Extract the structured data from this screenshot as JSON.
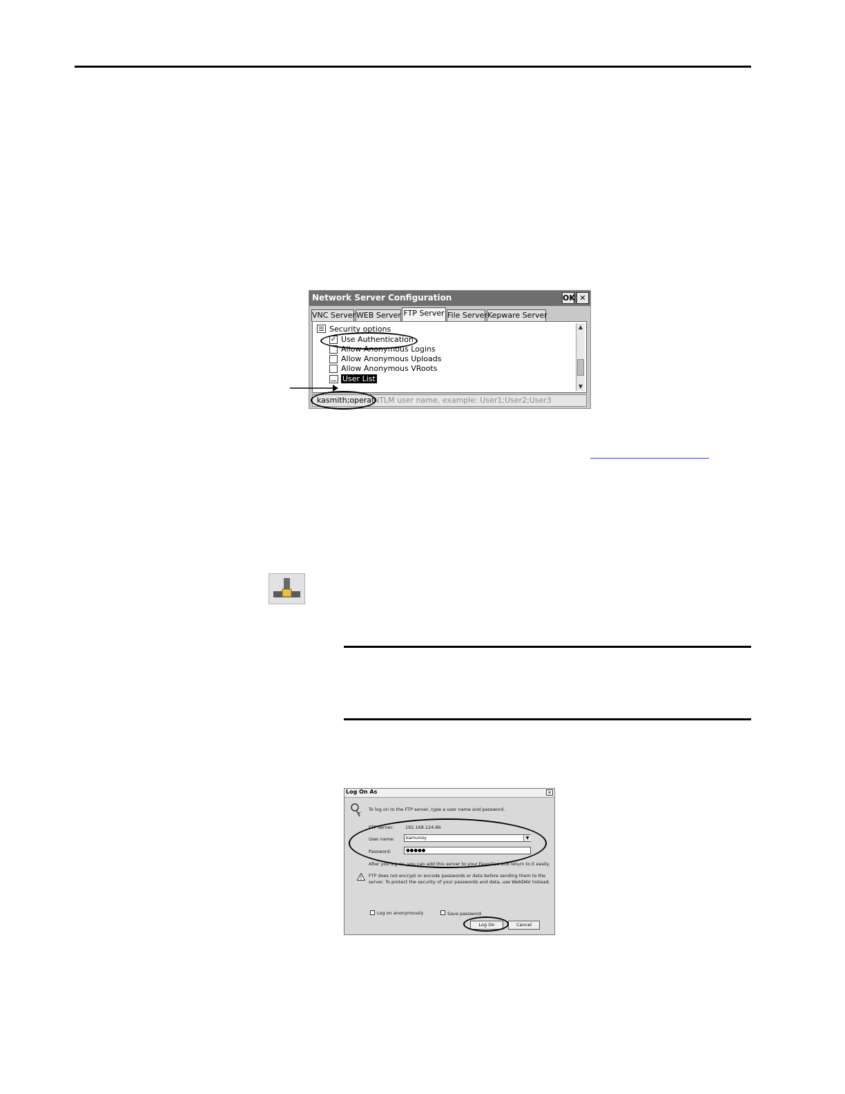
{
  "network_server_config": {
    "title": "Network Server Configuration",
    "ok_label": "OK",
    "close_label": "✕",
    "tabs": [
      {
        "label": "VNC Server"
      },
      {
        "label": "WEB Server"
      },
      {
        "label": "FTP Server"
      },
      {
        "label": "File Server"
      },
      {
        "label": "Kepware Server"
      }
    ],
    "active_tab": "FTP Server",
    "tree": {
      "group_label": "Security options",
      "items": [
        {
          "label": "Use Authentication",
          "checked": true
        },
        {
          "label": "Allow Anonymous Logins",
          "checked": false
        },
        {
          "label": "Allow Anonymous Uploads",
          "checked": false
        },
        {
          "label": "Allow Anonymous VRoots",
          "checked": false
        },
        {
          "label": "User List",
          "selected": true
        }
      ]
    },
    "edit_value": "kasmith;operat",
    "edit_hint": "NTLM user name, example: User1;User2;User3"
  },
  "icon": {
    "name": "network-icon"
  },
  "logon_dialog": {
    "title": "Log On As",
    "close_label": "✕",
    "instruction": "To log on to the FTP server, type a user name and password.",
    "ftp_server_label": "FTP server:",
    "ftp_server_value": "192.168.124.86",
    "user_name_label": "User name:",
    "user_name_value": "kamunoy",
    "password_label": "Password:",
    "password_value": "●●●●●",
    "after_text": "After you log on, you can add this server to your Favorites and return to it easily.",
    "warning_text_1": "FTP does not encrypt or encode passwords or data before sending them to the",
    "warning_text_2": "server. To protect the security of your passwords and data, use WebDAV instead.",
    "anon_label": "Log on anonymously",
    "save_label": "Save password",
    "logon_button": "Log On",
    "cancel_button": "Cancel"
  },
  "colors": {
    "dialog_titlebar": "#6e6e6e",
    "link": "#3a3ad8"
  }
}
